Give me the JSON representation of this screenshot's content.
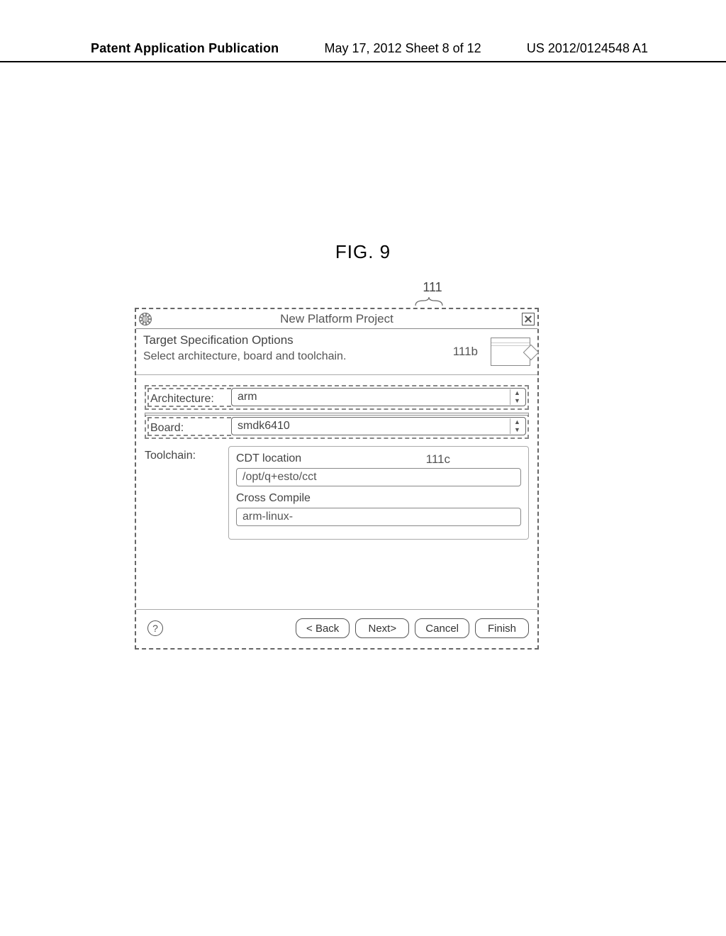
{
  "page_header": {
    "left": "Patent Application Publication",
    "middle": "May 17, 2012  Sheet 8 of 12",
    "right": "US 2012/0124548 A1"
  },
  "figure_label": "FIG. 9",
  "callouts": {
    "win": "111",
    "arch_board": "111b",
    "toolchain": "111c"
  },
  "dialog": {
    "title": "New Platform Project",
    "intro": {
      "heading": "Target Specification Options",
      "subheading": "Select architecture, board and toolchain."
    },
    "fields": {
      "architecture": {
        "label": "Architecture:",
        "value": "arm"
      },
      "board": {
        "label": "Board:",
        "value": "smdk6410"
      },
      "toolchain": {
        "label": "Toolchain:",
        "cdt_label": "CDT location",
        "cdt_value": "/opt/q+esto/cct",
        "cc_label": "Cross Compile",
        "cc_value": "arm-linux-"
      }
    },
    "buttons": {
      "back": "< Back",
      "next": "Next>",
      "cancel": "Cancel",
      "finish": "Finish"
    }
  }
}
